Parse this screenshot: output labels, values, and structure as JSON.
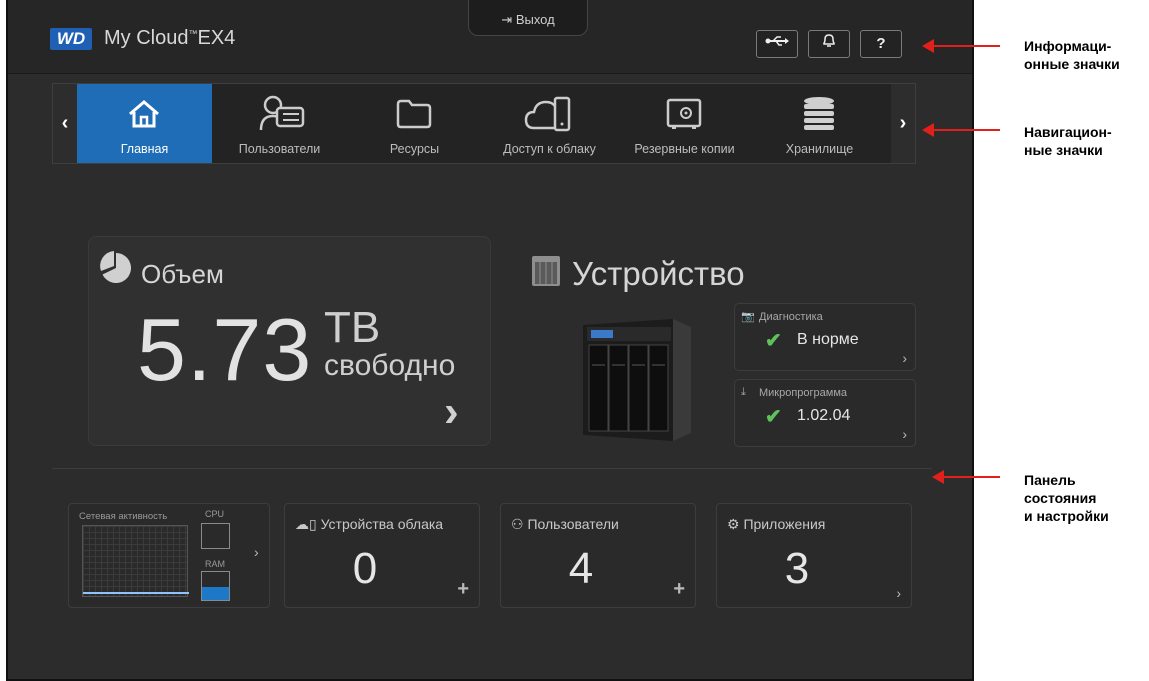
{
  "header": {
    "brand_logo": "WD",
    "app_title": "My Cloud",
    "app_title_sup": "™",
    "app_model": "EX4",
    "logout_label": "Выход",
    "logout_icon": "exit-icon",
    "info_icons": [
      {
        "name": "usb-icon",
        "glyph": "⟷"
      },
      {
        "name": "bell-icon",
        "glyph": "🔔"
      },
      {
        "name": "help-icon",
        "glyph": "?"
      }
    ]
  },
  "nav": {
    "prev_glyph": "‹",
    "next_glyph": "›",
    "items": [
      {
        "label": "Главная",
        "icon": "home-icon",
        "active": true
      },
      {
        "label": "Пользователи",
        "icon": "users-icon",
        "active": false
      },
      {
        "label": "Ресурсы",
        "icon": "folder-icon",
        "active": false
      },
      {
        "label": "Доступ к облаку",
        "icon": "cloud-device-icon",
        "active": false
      },
      {
        "label": "Резервные копии",
        "icon": "safe-icon",
        "active": false
      },
      {
        "label": "Хранилище",
        "icon": "storage-icon",
        "active": false
      }
    ]
  },
  "capacity": {
    "title": "Объем",
    "value": "5.73",
    "unit": "TB",
    "suffix": "свободно",
    "arrow": "›"
  },
  "device": {
    "title": "Устройство",
    "diagnostics": {
      "label": "Диагностика",
      "value": "В норме",
      "arrow": "›"
    },
    "firmware": {
      "label": "Микропрограмма",
      "value": "1.02.04",
      "arrow": "›"
    }
  },
  "status": {
    "network": {
      "label": "Сетевая активность",
      "cpu_label": "CPU",
      "ram_label": "RAM",
      "ram_fill_pct": 45,
      "arrow": "›"
    },
    "cloud_devices": {
      "title": "Устройства облака",
      "count": "0",
      "action": "+"
    },
    "users": {
      "title": "Пользователи",
      "count": "4",
      "action": "+"
    },
    "apps": {
      "title": "Приложения",
      "count": "3",
      "action": "›"
    }
  },
  "annotations": [
    {
      "text_line1": "Информаци-",
      "text_line2": "онные значки"
    },
    {
      "text_line1": "Навигацион-",
      "text_line2": "ные значки"
    },
    {
      "text_line1": "Панель",
      "text_line2": "состояния",
      "text_line3": "и настройки"
    }
  ],
  "colors": {
    "accent": "#1f6db6",
    "ok": "#5fc15a",
    "annotation": "#e0201b",
    "background": "#2c2c2c"
  }
}
